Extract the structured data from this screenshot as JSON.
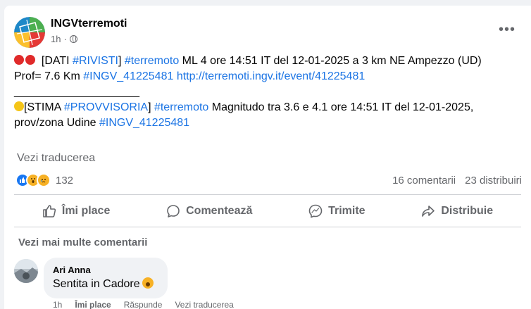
{
  "post": {
    "author": "INGVterremoti",
    "time": "1h",
    "line1_prefix": "[DATI ",
    "line1_hash1": "#RIVISTI",
    "line1_mid": "] ",
    "line1_hash2": "#terremoto",
    "line1_rest": " ML 4 ore 14:51 IT del 12-01-2025  a 3 km NE Ampezzo (UD)",
    "line2_prefix": "Prof= 7.6 Km ",
    "line2_hash": "#INGV_41225481",
    "line2_link": "http://terremoti.ingv.it/event/41225481",
    "separator": "____________________",
    "line3_prefix": "[STIMA ",
    "line3_hash1": "#PROVVISORIA",
    "line3_mid": "] ",
    "line3_hash2": "#terremoto",
    "line3_rest": " Magnitudo tra 3.6 e 4.1 ore 14:51 IT del 12-01-2025,",
    "line4_prefix": "prov/zona Udine ",
    "line4_hash": "#INGV_41225481",
    "see_translation": "Vezi traducerea"
  },
  "stats": {
    "reactions": "132",
    "comments": "16 comentarii",
    "shares": "23 distribuiri"
  },
  "actions": {
    "like": "Îmi place",
    "comment": "Comentează",
    "send": "Trimite",
    "share": "Distribuie"
  },
  "comments_section": {
    "more_comments": "Vezi mai multe comentarii",
    "comment": {
      "author": "Ari Anna",
      "text": "Sentita in Cadore",
      "time": "1h",
      "like": "Îmi place",
      "reply": "Răspunde",
      "translate": "Vezi traducerea"
    }
  },
  "colors": {
    "link": "#1b74e4",
    "muted": "#65676b",
    "like_blue": "#1877f2"
  }
}
